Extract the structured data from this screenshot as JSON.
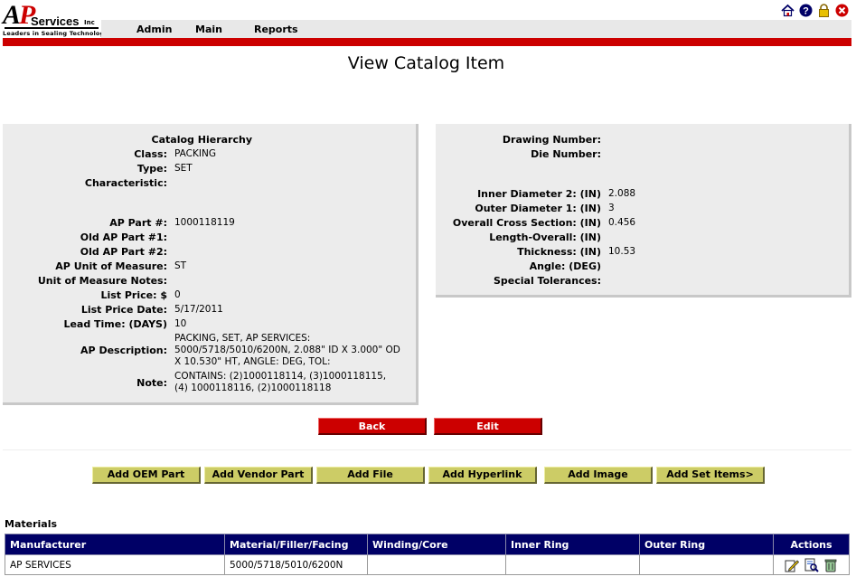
{
  "header": {
    "logo": {
      "letters_a": "A",
      "letters_p": "P",
      "services": "Services",
      "inc": "Inc",
      "tagline": "Leaders in Sealing Technologies"
    },
    "nav": [
      "Admin",
      "Main",
      "Reports"
    ],
    "icons": [
      "home-icon",
      "help-icon",
      "lock-icon",
      "close-icon"
    ]
  },
  "page_title": "View Catalog Item",
  "left_panel": {
    "section_title": "Catalog Hierarchy",
    "rows": [
      {
        "label": "Class:",
        "value": "PACKING"
      },
      {
        "label": "Type:",
        "value": "SET"
      },
      {
        "label": "Characteristic:",
        "value": ""
      },
      {
        "label": "AP Part #:",
        "value": "1000118119"
      },
      {
        "label": "Old AP Part #1:",
        "value": ""
      },
      {
        "label": "Old AP Part #2:",
        "value": ""
      },
      {
        "label": "AP Unit of Measure:",
        "value": "ST"
      },
      {
        "label": "Unit of Measure Notes:",
        "value": ""
      },
      {
        "label": "List Price: $",
        "value": "0"
      },
      {
        "label": "List Price Date:",
        "value": "5/17/2011"
      },
      {
        "label": "Lead Time: (DAYS)",
        "value": "10"
      },
      {
        "label": "AP Description:",
        "value": "PACKING, SET, AP SERVICES: 5000/5718/5010/6200N, 2.088\" ID X 3.000\" OD X 10.530\" HT, ANGLE: DEG, TOL:"
      },
      {
        "label": "Note:",
        "value": "CONTAINS: (2)1000118114, (3)1000118115, (4) 1000118116, (2)1000118118"
      }
    ]
  },
  "right_panel": {
    "rows": [
      {
        "label": "Drawing Number:",
        "value": ""
      },
      {
        "label": "Die Number:",
        "value": ""
      },
      {
        "label": "Inner Diameter 2: (IN)",
        "value": "2.088"
      },
      {
        "label": "Outer Diameter 1: (IN)",
        "value": "3"
      },
      {
        "label": "Overall Cross Section: (IN)",
        "value": "0.456"
      },
      {
        "label": "Length-Overall: (IN)",
        "value": ""
      },
      {
        "label": "Thickness: (IN)",
        "value": "10.53"
      },
      {
        "label": "Angle: (DEG)",
        "value": ""
      },
      {
        "label": "Special Tolerances:",
        "value": ""
      }
    ]
  },
  "buttons": {
    "back": "Back",
    "edit": "Edit"
  },
  "add_buttons": [
    "Add OEM Part",
    "Add Vendor Part",
    "Add File",
    "Add Hyperlink",
    "Add Image",
    "Add Set Items>"
  ],
  "materials": {
    "title": "Materials",
    "columns": [
      "Manufacturer",
      "Material/Filler/Facing",
      "Winding/Core",
      "Inner Ring",
      "Outer Ring",
      "Actions"
    ],
    "rows": [
      {
        "manufacturer": "AP SERVICES",
        "material": "5000/5718/5010/6200N",
        "winding": "",
        "inner_ring": "",
        "outer_ring": ""
      }
    ],
    "action_icons": [
      "edit-icon",
      "view-icon",
      "delete-icon"
    ]
  },
  "colors": {
    "brand_red": "#cc0000",
    "table_header": "#000066",
    "add_button": "#cccc66",
    "panel": "#ececec"
  }
}
